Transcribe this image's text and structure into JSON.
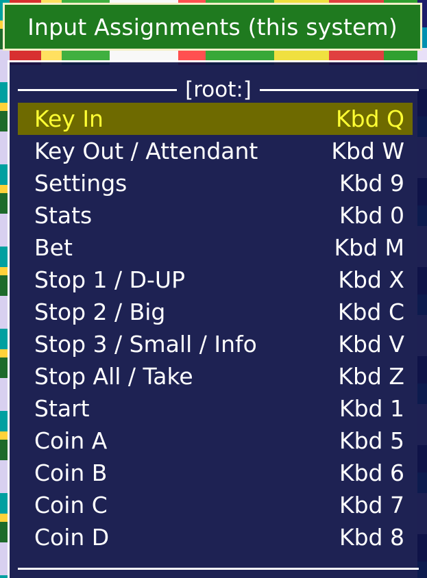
{
  "window": {
    "title": "Input Assignments (this system)"
  },
  "menu": {
    "heading": "[root:]",
    "selected_index": 0,
    "items": [
      {
        "label": "Key In",
        "value": "Kbd Q"
      },
      {
        "label": "Key Out / Attendant",
        "value": "Kbd W"
      },
      {
        "label": "Settings",
        "value": "Kbd 9"
      },
      {
        "label": "Stats",
        "value": "Kbd 0"
      },
      {
        "label": "Bet",
        "value": "Kbd M"
      },
      {
        "label": "Stop 1 / D-UP",
        "value": "Kbd X"
      },
      {
        "label": "Stop 2 / Big",
        "value": "Kbd C"
      },
      {
        "label": "Stop 3 / Small / Info",
        "value": "Kbd V"
      },
      {
        "label": "Stop All / Take",
        "value": "Kbd Z"
      },
      {
        "label": "Start",
        "value": "Kbd 1"
      },
      {
        "label": "Coin A",
        "value": "Kbd 5"
      },
      {
        "label": "Coin B",
        "value": "Kbd 6"
      },
      {
        "label": "Coin C",
        "value": "Kbd 7"
      },
      {
        "label": "Coin D",
        "value": "Kbd 8"
      }
    ]
  },
  "colors": {
    "title_bg": "#1f7a1f",
    "panel_bg": "#0e1246",
    "selected_bg": "#6e6a00",
    "selected_text": "#ffff33",
    "text": "#ffffff"
  }
}
